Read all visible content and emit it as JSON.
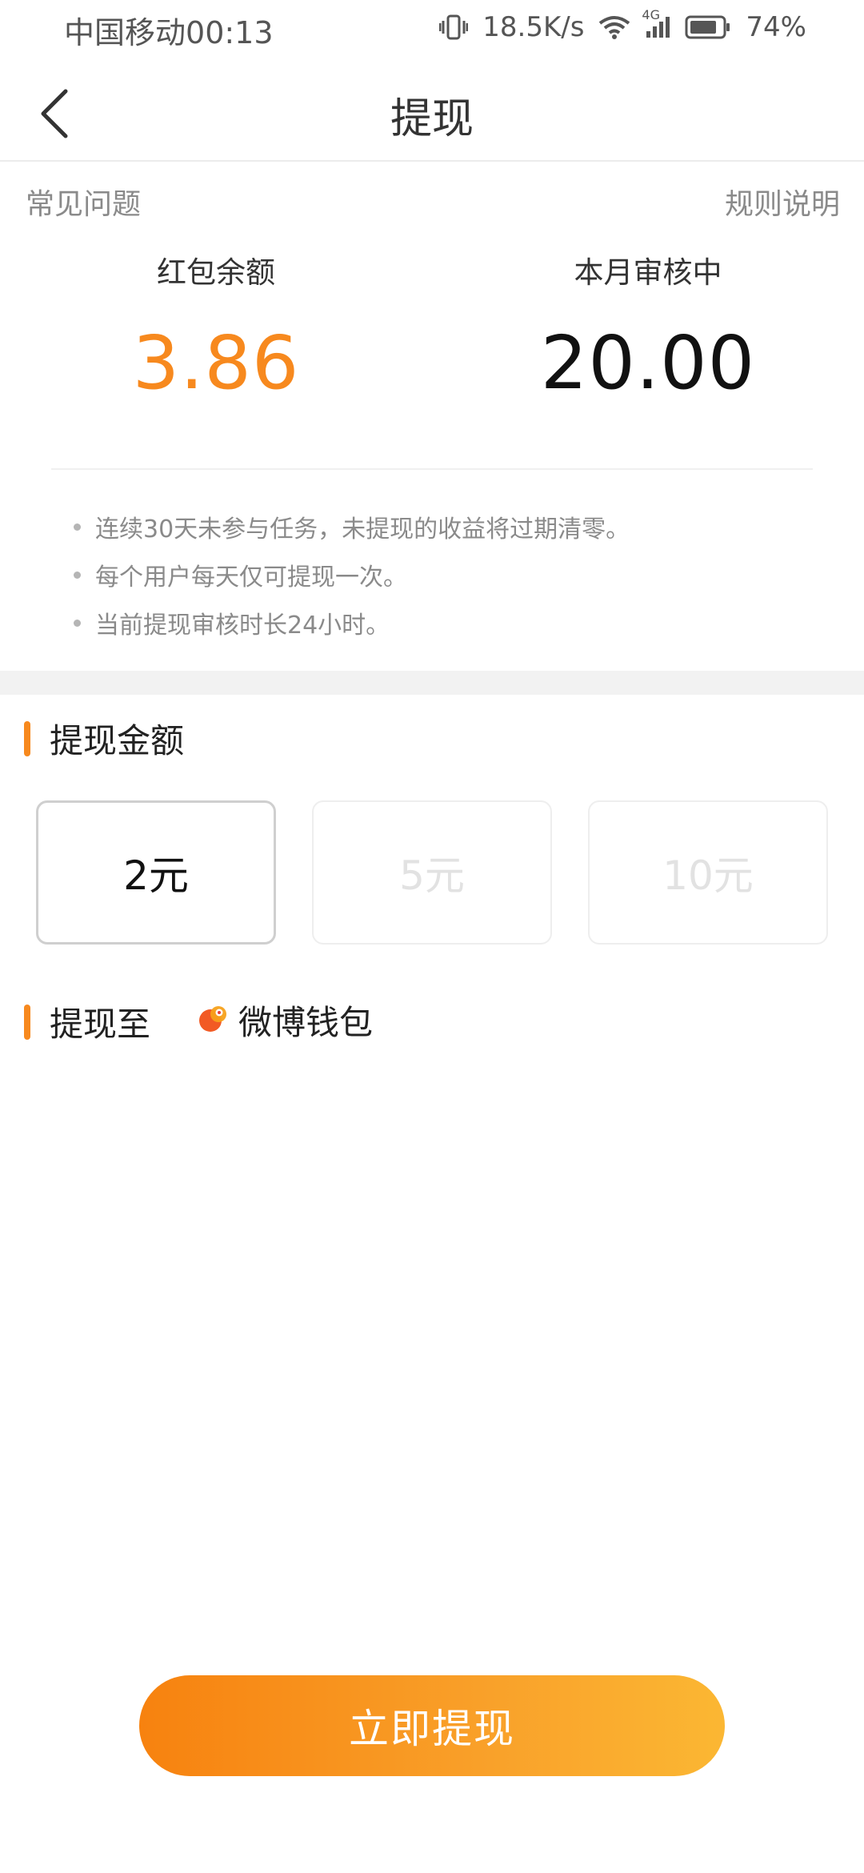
{
  "status_bar": {
    "carrier": "中国移动",
    "time": "00:13",
    "net_speed": "18.5K/s",
    "network_label": "4G",
    "battery": "74%"
  },
  "nav": {
    "title": "提现"
  },
  "links": {
    "faq": "常见问题",
    "rules": "规则说明"
  },
  "balances": {
    "red_packet_label": "红包余额",
    "red_packet_value": "3.86",
    "pending_label": "本月审核中",
    "pending_value": "20.00"
  },
  "notes": [
    "连续30天未参与任务，未提现的收益将过期清零。",
    "每个用户每天仅可提现一次。",
    "当前提现审核时长24小时。"
  ],
  "amount_section": {
    "title": "提现金额",
    "options": [
      {
        "label": "2元",
        "state": "selected"
      },
      {
        "label": "5元",
        "state": "disabled"
      },
      {
        "label": "10元",
        "state": "disabled"
      }
    ]
  },
  "withdraw_to": {
    "title": "提现至",
    "wallet_name": "微博钱包"
  },
  "cta": {
    "label": "立即提现"
  },
  "colors": {
    "accent": "#f7891e",
    "muted_text": "#8a8a8a"
  }
}
